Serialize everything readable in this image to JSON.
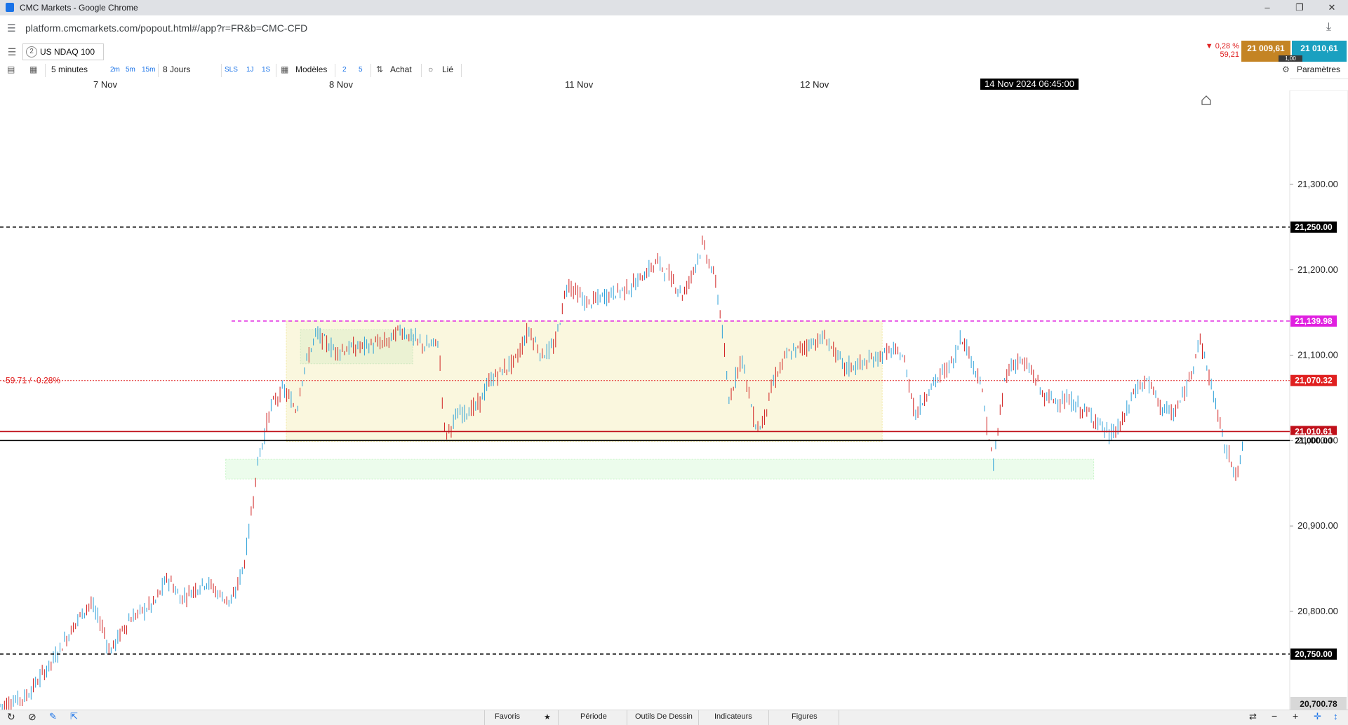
{
  "window": {
    "title": "CMC Markets - Google Chrome",
    "url": "platform.cmcmarkets.com/popout.html#/app?r=FR&b=CMC-CFD"
  },
  "instrument": {
    "badge": "2",
    "name": "US NDAQ 100",
    "change_pct": "0,28 %",
    "change_pts": "59,21",
    "sell": "21 009,61",
    "buy": "21 010,61",
    "spread": "1,00"
  },
  "toolbar": {
    "timeframe": "5 minutes",
    "quick_2m": "2m",
    "quick_5m": "5m",
    "quick_15m": "15m",
    "range": "8 Jours",
    "sls": "SLS",
    "r1j": "1J",
    "r1s": "1S",
    "models": "Modèles",
    "n2": "2",
    "n5": "5",
    "buy": "Achat",
    "linked": "Lié",
    "settings": "Paramètres"
  },
  "dates": {
    "d1": "7 Nov",
    "d2": "8 Nov",
    "d3": "11 Nov",
    "d4": "12 Nov",
    "cursor": "14 Nov 2024 06:45:00"
  },
  "chart_data": {
    "type": "candlestick",
    "instrument": "US NDAQ 100",
    "interval": "5 minutes",
    "ylim": [
      20685,
      21410
    ],
    "price_ticks": [
      "21,300.00",
      "21,200.00",
      "21,100.00",
      "21,000.00",
      "20,900.00",
      "20,800.00"
    ],
    "price_tick_values": [
      21300,
      21200,
      21100,
      21000,
      20900,
      20800
    ],
    "x_labels": [
      "7 Nov",
      "8 Nov",
      "11 Nov",
      "12 Nov"
    ],
    "lines": [
      {
        "label": "21,250.00",
        "value": 21250,
        "style": "dashed",
        "color": "#000000"
      },
      {
        "label": "21,139.98",
        "value": 21139.98,
        "style": "dashed",
        "color": "#e020e0"
      },
      {
        "label": "21,070.32",
        "value": 21070.32,
        "style": "dotted",
        "color": "#e02020"
      },
      {
        "label": "21,010.61",
        "value": 21010.61,
        "style": "solid",
        "color": "#c0101a"
      },
      {
        "label": "21,000.00",
        "value": 21000,
        "style": "solid",
        "color": "#000000"
      },
      {
        "label": "20,750.00",
        "value": 20750,
        "style": "dashed",
        "color": "#000000"
      }
    ],
    "last_price_label": "20,700.78",
    "change_annotation": "-59.71 / -0.28%",
    "zones": [
      {
        "from": 20999,
        "to": 21140,
        "color": "#f2e8a0"
      },
      {
        "from": 21090,
        "to": 21130,
        "color": "#cfe8c0"
      },
      {
        "from": 20955,
        "to": 20978,
        "color": "#c8f5c8"
      }
    ],
    "path": [
      [
        0.0,
        20690
      ],
      [
        0.02,
        20700
      ],
      [
        0.04,
        20740
      ],
      [
        0.06,
        20790
      ],
      [
        0.07,
        20810
      ],
      [
        0.08,
        20780
      ],
      [
        0.085,
        20752
      ],
      [
        0.1,
        20790
      ],
      [
        0.12,
        20810
      ],
      [
        0.13,
        20840
      ],
      [
        0.14,
        20815
      ],
      [
        0.16,
        20835
      ],
      [
        0.17,
        20820
      ],
      [
        0.18,
        20810
      ],
      [
        0.19,
        20860
      ],
      [
        0.2,
        20975
      ],
      [
        0.21,
        21040
      ],
      [
        0.22,
        21060
      ],
      [
        0.23,
        21035
      ],
      [
        0.235,
        21080
      ],
      [
        0.245,
        21125
      ],
      [
        0.26,
        21105
      ],
      [
        0.28,
        21110
      ],
      [
        0.3,
        21115
      ],
      [
        0.31,
        21130
      ],
      [
        0.33,
        21110
      ],
      [
        0.34,
        21115
      ],
      [
        0.345,
        21005
      ],
      [
        0.355,
        21030
      ],
      [
        0.37,
        21040
      ],
      [
        0.38,
        21070
      ],
      [
        0.4,
        21095
      ],
      [
        0.41,
        21130
      ],
      [
        0.42,
        21100
      ],
      [
        0.43,
        21110
      ],
      [
        0.44,
        21185
      ],
      [
        0.455,
        21160
      ],
      [
        0.47,
        21170
      ],
      [
        0.49,
        21180
      ],
      [
        0.51,
        21210
      ],
      [
        0.53,
        21170
      ],
      [
        0.545,
        21230
      ],
      [
        0.555,
        21185
      ],
      [
        0.56,
        21130
      ],
      [
        0.565,
        21045
      ],
      [
        0.575,
        21100
      ],
      [
        0.585,
        21020
      ],
      [
        0.59,
        21015
      ],
      [
        0.6,
        21070
      ],
      [
        0.61,
        21100
      ],
      [
        0.63,
        21115
      ],
      [
        0.64,
        21120
      ],
      [
        0.655,
        21085
      ],
      [
        0.67,
        21090
      ],
      [
        0.69,
        21105
      ],
      [
        0.7,
        21100
      ],
      [
        0.71,
        21030
      ],
      [
        0.72,
        21060
      ],
      [
        0.74,
        21095
      ],
      [
        0.745,
        21125
      ],
      [
        0.76,
        21070
      ],
      [
        0.77,
        20970
      ],
      [
        0.78,
        21080
      ],
      [
        0.79,
        21095
      ],
      [
        0.8,
        21080
      ],
      [
        0.81,
        21050
      ],
      [
        0.83,
        21045
      ],
      [
        0.85,
        21025
      ],
      [
        0.86,
        21005
      ],
      [
        0.87,
        21020
      ],
      [
        0.88,
        21060
      ],
      [
        0.89,
        21070
      ],
      [
        0.9,
        21040
      ],
      [
        0.91,
        21030
      ],
      [
        0.92,
        21060
      ],
      [
        0.93,
        21120
      ],
      [
        0.94,
        21060
      ],
      [
        0.95,
        20990
      ],
      [
        0.96,
        20960
      ],
      [
        0.965,
        21010
      ]
    ]
  }
}
